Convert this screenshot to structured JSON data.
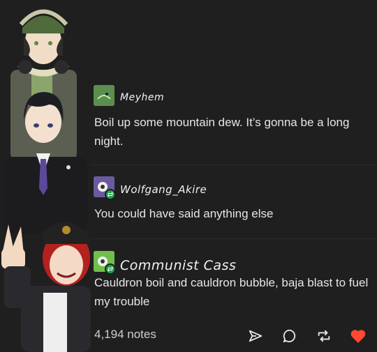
{
  "replies": [
    {
      "username": "Meyhem",
      "text": "Boil up some mountain dew.  It’s gonna be a long night."
    },
    {
      "username": "Wolfgang_Akire",
      "text": "You could have said anything else"
    },
    {
      "username": "Communist Cass",
      "text": "Cauldron boil and cauldron bubble, baja blast to fuel my trouble"
    }
  ],
  "footer": {
    "notes": "4,194 notes",
    "icons": [
      "share-icon",
      "comment-icon",
      "reblog-icon",
      "heart-icon"
    ]
  },
  "colors": {
    "background": "#1f1f1f",
    "heart": "#ff4930",
    "reblog_badge": "#1aa34a"
  }
}
